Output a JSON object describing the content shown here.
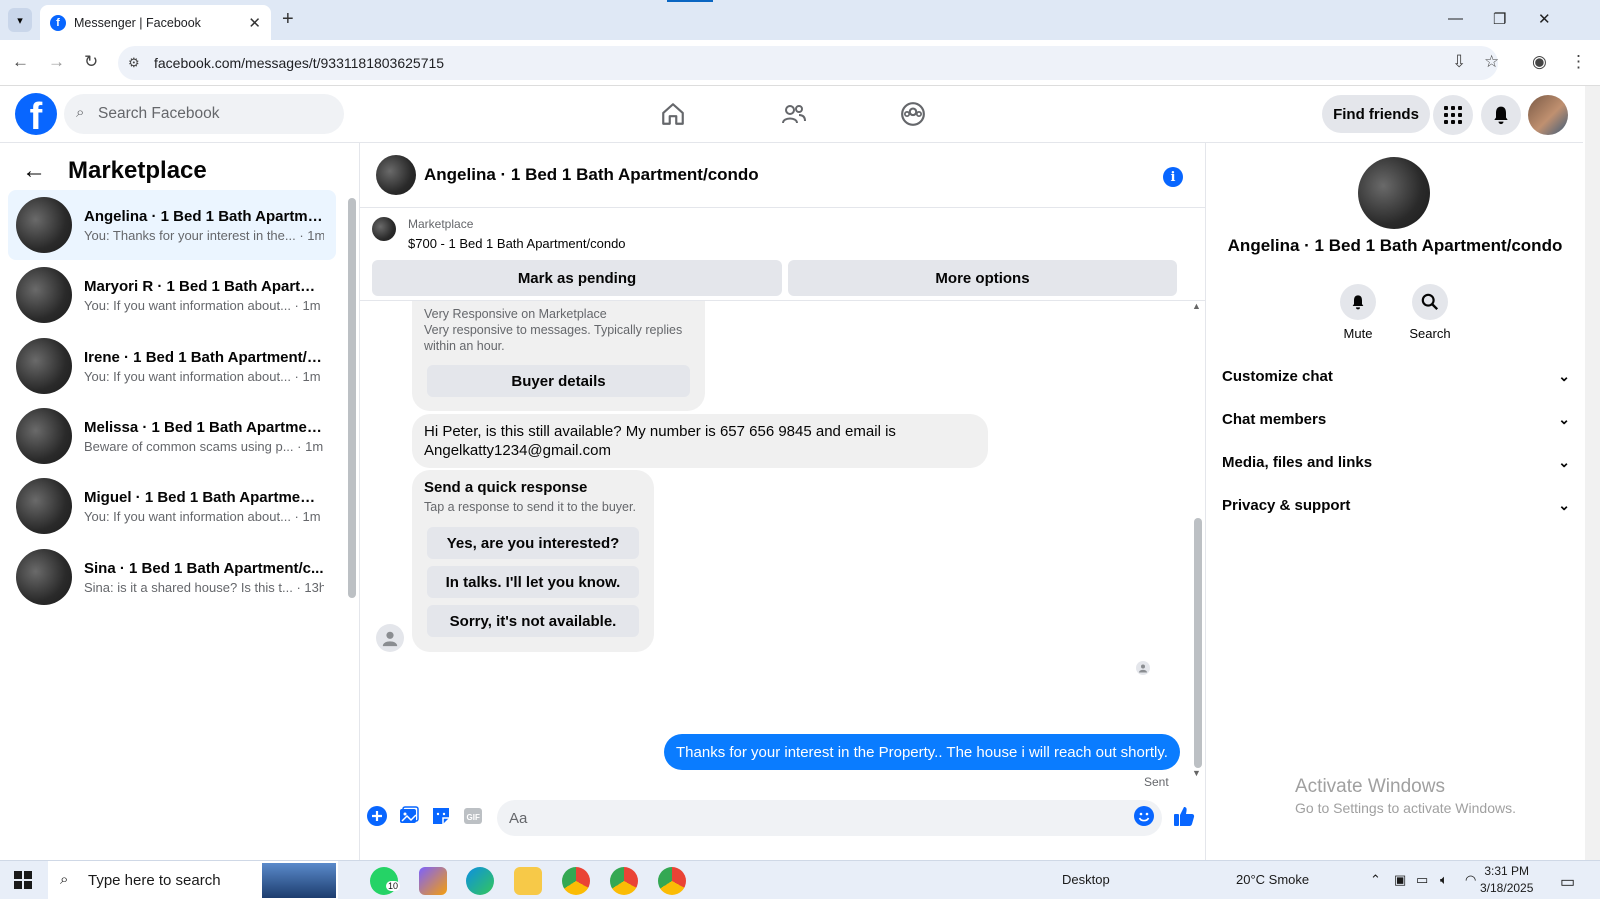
{
  "browser": {
    "tab_title": "Messenger | Facebook",
    "fb_glyph": "f",
    "url": "facebook.com/messages/t/9331181803625715",
    "close_tab": "✕",
    "new_tab": "+",
    "tab_list_icon": "chevron-down-icon"
  },
  "header": {
    "search_placeholder": "Search Facebook",
    "find_friends": "Find friends"
  },
  "left": {
    "title": "Marketplace",
    "conversations": [
      {
        "title": "Angelina · 1 Bed 1 Bath Apartme...",
        "preview": "You: Thanks for your interest in the... · 1m",
        "active": true
      },
      {
        "title": "Maryori R · 1 Bed 1 Bath Apartm...",
        "preview": "You: If you want information about... · 1m"
      },
      {
        "title": "Irene · 1 Bed 1 Bath Apartment/c...",
        "preview": "You: If you want information about... · 1m"
      },
      {
        "title": "Melissa · 1 Bed 1 Bath Apartmen...",
        "preview": "Beware of common scams using p... · 1m"
      },
      {
        "title": "Miguel · 1 Bed 1 Bath Apartment...",
        "preview": "You: If you want information about... · 1m"
      },
      {
        "title": "Sina · 1 Bed 1 Bath Apartment/c...",
        "preview": "Sina: is it a shared house? Is this t... · 13h"
      }
    ]
  },
  "chat": {
    "name": "Angelina · 1 Bed 1 Bath Apartment/condo",
    "marketplace_label": "Marketplace",
    "listing": "$700 - 1 Bed 1 Bath Apartment/condo",
    "mark_pending": "Mark as pending",
    "more_options": "More options",
    "buyer_line1": "Very Responsive on Marketplace",
    "buyer_line2": "Very responsive to messages. Typically replies within an hour.",
    "buyer_details": "Buyer details",
    "incoming_message": "Hi Peter, is this still available? My number is 657 656 9845 and email is Angelkatty1234@gmail.com",
    "quick_title": "Send a quick response",
    "quick_sub": "Tap a response to send it to the buyer.",
    "quick_replies": [
      "Yes, are you interested?",
      "In talks. I'll let you know.",
      "Sorry, it's not available."
    ],
    "sent_message": "Thanks for your interest in the Property.. The house i will reach  out shortly.",
    "sent_status": "Sent",
    "composer_placeholder": "Aa"
  },
  "right": {
    "name": "Angelina · 1 Bed 1 Bath Apartment/condo",
    "mute": "Mute",
    "search": "Search",
    "sections": [
      "Customize chat",
      "Chat members",
      "Media, files and links",
      "Privacy & support"
    ]
  },
  "watermark": {
    "line1": "Activate Windows",
    "line2": "Go to Settings to activate Windows."
  },
  "taskbar": {
    "search_placeholder": "Type here to search",
    "whatsapp_badge": "10",
    "desktop": "Desktop",
    "weather": "20°C  Smoke",
    "time": "3:31 PM",
    "date": "3/18/2025"
  },
  "colors": {
    "accent": "#0866ff",
    "sent_bubble": "#0a7cff"
  }
}
